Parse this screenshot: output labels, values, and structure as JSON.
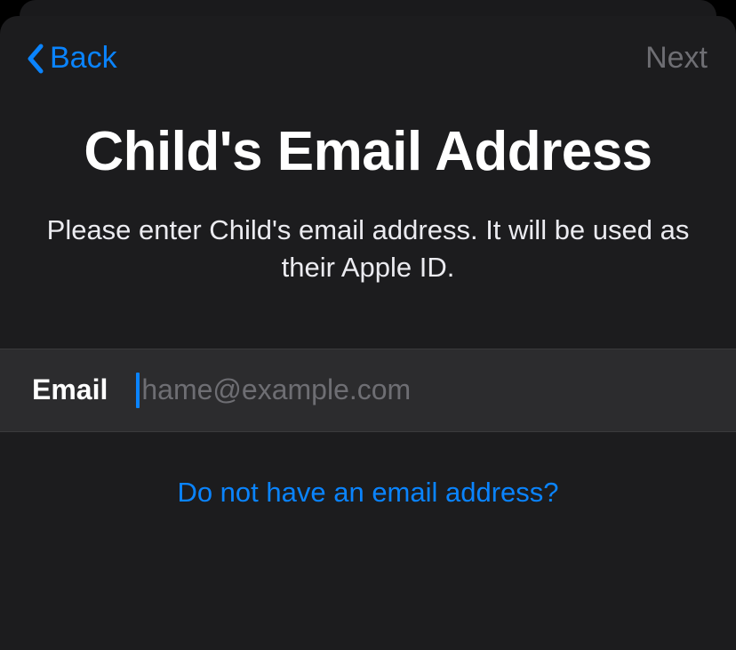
{
  "nav": {
    "back_label": "Back",
    "next_label": "Next"
  },
  "header": {
    "title": "Child's Email Address",
    "subtitle": "Please enter Child's email address. It will be used as their Apple ID."
  },
  "form": {
    "email_label": "Email",
    "email_placeholder": "hame@example.com",
    "email_value": ""
  },
  "links": {
    "no_email": "Do not have an email address?"
  },
  "colors": {
    "accent": "#0a84ff",
    "disabled": "#6e6e73",
    "background": "#1c1c1e",
    "input_bg": "#2c2c2e"
  }
}
